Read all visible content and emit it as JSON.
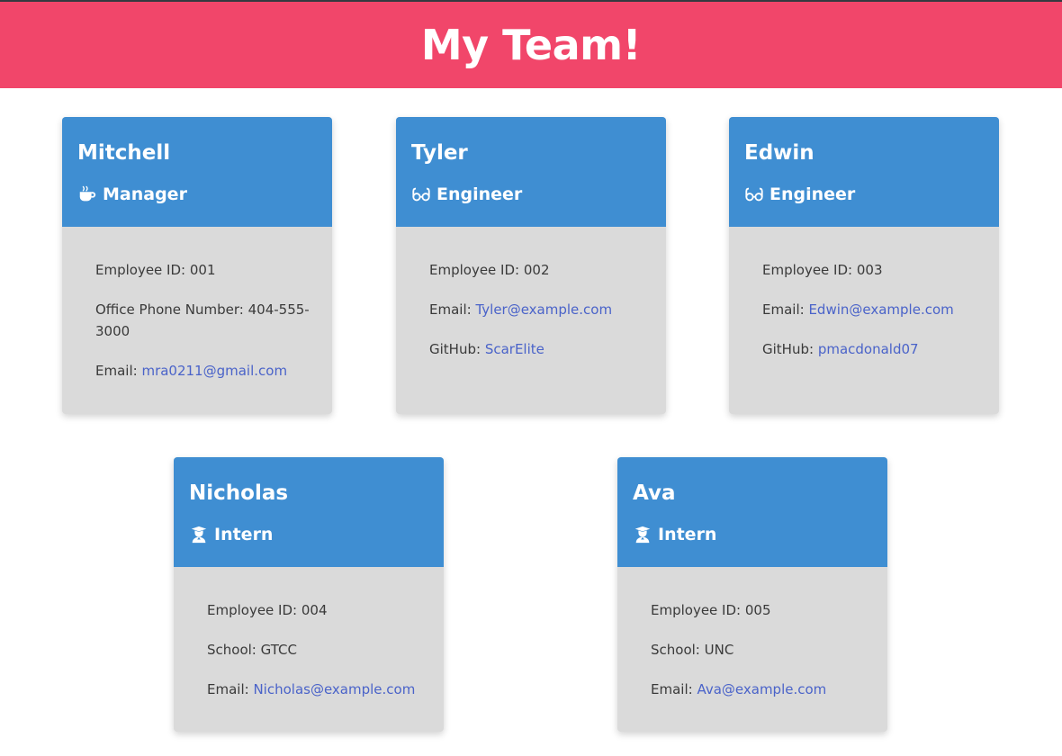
{
  "header": {
    "title": "My Team!"
  },
  "colors": {
    "header_bg": "#f1466a",
    "card_head_bg": "#3f8ed2",
    "card_body_bg": "#dadada",
    "link": "#4a63c9"
  },
  "employees": [
    {
      "name": "Mitchell",
      "role": "Manager",
      "role_icon": "coffee-icon",
      "id_label": "Employee ID:",
      "id": "001",
      "extra_label": "Office Phone Number:",
      "extra_value": "404-555-3000",
      "email_label": "Email:",
      "email": "mra0211@gmail.com"
    },
    {
      "name": "Tyler",
      "role": "Engineer",
      "role_icon": "glasses-icon",
      "id_label": "Employee ID:",
      "id": "002",
      "email_label": "Email:",
      "email": "Tyler@example.com",
      "github_label": "GitHub:",
      "github": "ScarElite"
    },
    {
      "name": "Edwin",
      "role": "Engineer",
      "role_icon": "glasses-icon",
      "id_label": "Employee ID:",
      "id": "003",
      "email_label": "Email:",
      "email": "Edwin@example.com",
      "github_label": "GitHub:",
      "github": "pmacdonald07"
    },
    {
      "name": "Nicholas",
      "role": "Intern",
      "role_icon": "graduate-icon",
      "id_label": "Employee ID:",
      "id": "004",
      "school_label": "School:",
      "school": "GTCC",
      "email_label": "Email:",
      "email": "Nicholas@example.com"
    },
    {
      "name": "Ava",
      "role": "Intern",
      "role_icon": "graduate-icon",
      "id_label": "Employee ID:",
      "id": "005",
      "school_label": "School:",
      "school": "UNC",
      "email_label": "Email:",
      "email": "Ava@example.com"
    }
  ]
}
